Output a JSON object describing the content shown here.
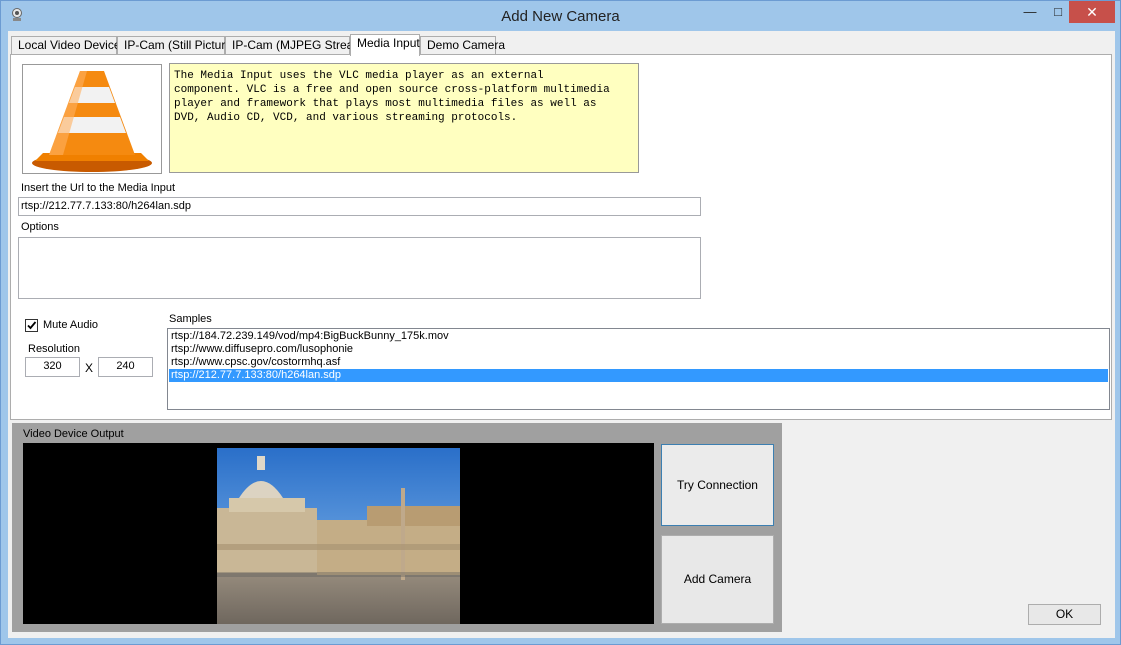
{
  "window": {
    "title": "Add New Camera",
    "minimize_glyph": "—",
    "maximize_glyph": "□",
    "close_glyph": "✕"
  },
  "tabs": [
    {
      "label": "Local Video Device"
    },
    {
      "label": "IP-Cam (Still Picture)"
    },
    {
      "label": "IP-Cam (MJPEG Stream)"
    },
    {
      "label": "Media Input"
    },
    {
      "label": "Demo Camera"
    }
  ],
  "media_input": {
    "description": "The Media Input uses the VLC media player as an external\ncomponent. VLC is a free and open source cross-platform multimedia\nplayer and framework that plays most multimedia files as well as\nDVD, Audio CD, VCD, and various streaming protocols.",
    "url_label": "Insert the Url to the Media Input",
    "url_value": "rtsp://212.77.7.133:80/h264lan.sdp",
    "options_label": "Options",
    "options_value": "",
    "mute_audio_label": "Mute Audio",
    "mute_audio_checked": true,
    "resolution_label": "Resolution",
    "width": "320",
    "x_label": "X",
    "height": "240",
    "samples_label": "Samples",
    "samples": [
      "rtsp://184.72.239.149/vod/mp4:BigBuckBunny_175k.mov",
      "rtsp://www.diffusepro.com/lusophonie",
      "rtsp://www.cpsc.gov/costormhq.asf",
      "rtsp://212.77.7.133:80/h264lan.sdp"
    ],
    "selected_sample": 3
  },
  "output": {
    "label": "Video Device Output",
    "try_connection": "Try Connection",
    "add_camera": "Add Camera"
  },
  "ok_button": "OK",
  "icons": {
    "app": "webcam-icon",
    "logo": "vlc-cone-icon"
  },
  "colors": {
    "titlebar": "#9fc6ea",
    "selection": "#3399ff",
    "description_bg": "#ffffc0",
    "close": "#c7504a"
  }
}
